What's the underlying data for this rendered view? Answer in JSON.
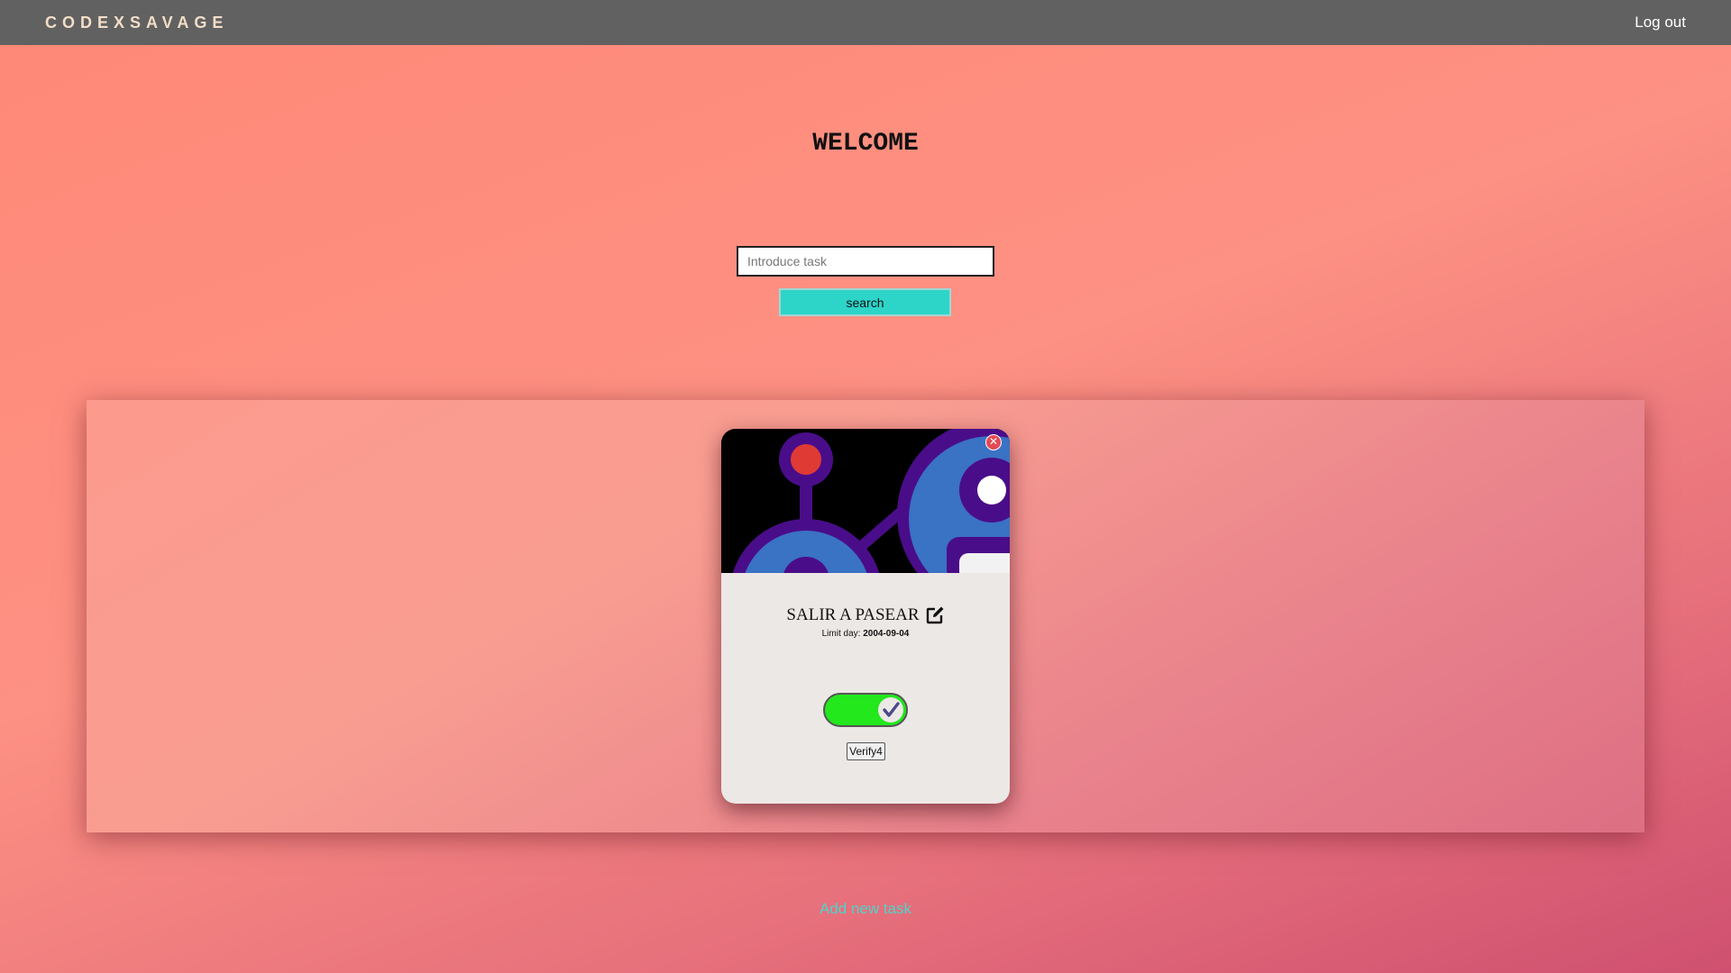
{
  "navbar": {
    "brand": "CODEXSAVAGE",
    "logout_label": "Log out"
  },
  "main": {
    "heading": "WELCOME"
  },
  "search": {
    "placeholder": "Introduce task",
    "value": "",
    "button_label": "search"
  },
  "task_card": {
    "image_icon": "robot-illustration",
    "close_icon": "close-icon",
    "title": "SALIR A PASEAR",
    "edit_icon": "edit-icon",
    "limit_label": "Limit day:",
    "limit_date": "2004-09-04",
    "completed": true,
    "verify_label": "Verify4"
  },
  "footer": {
    "add_task_label": "Add new task"
  },
  "colors": {
    "navbar": "#616161",
    "brand": "#f2ddc8",
    "search_button": "#2dd4c8",
    "toggle_on": "#22e81c",
    "link": "#4fd3c8"
  }
}
